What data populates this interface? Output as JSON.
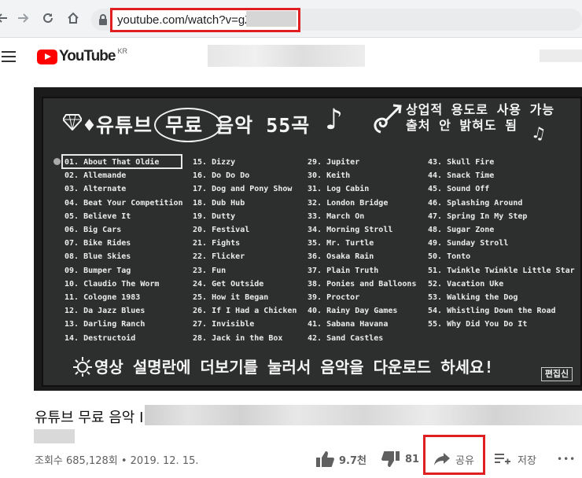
{
  "browser": {
    "url_visible": "youtube.com/watch?v=gZ"
  },
  "header": {
    "logo_text": "YouTube",
    "logo_region": "KR"
  },
  "video": {
    "title_line": "♦유튜브 무료 음악 55곡",
    "commercial_line1": "상업적 용도로 사용 가능",
    "commercial_line2": "출처 안 밝혀도 됨",
    "footer_note": "영상 설명란에 더보기를 눌러서 음악을 다운로드 하세요!",
    "editor_badge": "편집신",
    "songs": [
      [
        "01. About That Oldie",
        "02. Allemande",
        "03. Alternate",
        "04. Beat Your Competition",
        "05. Believe It",
        "06. Big Cars",
        "07. Bike Rides",
        "08. Blue Skies",
        "09. Bumper Tag",
        "10. Claudio The Worm",
        "11. Cologne 1983",
        "12. Da Jazz Blues",
        "13. Darling Ranch",
        "14. Destructoid"
      ],
      [
        "15. Dizzy",
        "16. Do Do Do",
        "17. Dog and Pony Show",
        "18. Dub Hub",
        "19. Dutty",
        "20. Festival",
        "21. Fights",
        "22. Flicker",
        "23. Fun",
        "24. Get Outside",
        "25. How it Began",
        "26. If I Had a Chicken",
        "27. Invisible",
        "28. Jack in the Box"
      ],
      [
        "29. Jupiter",
        "30. Keith",
        "31. Log Cabin",
        "32. London Bridge",
        "33. March On",
        "34. Morning Stroll",
        "35. Mr. Turtle",
        "36. Osaka Rain",
        "37. Plain Truth",
        "38. Ponies and Balloons",
        "39. Proctor",
        "40. Rainy Day Games",
        "41. Sabana Havana",
        "42. Sand Castles"
      ],
      [
        "43. Skull Fire",
        "44. Snack Time",
        "45. Sound Off",
        "46. Splashing Around",
        "47. Spring In My Step",
        "48. Sugar Zone",
        "49. Sunday Stroll",
        "50. Tonto",
        "51. Twinkle Twinkle Little Star",
        "52. Vacation Uke",
        "53. Walking the Dog",
        "54. Whistling Down the Road",
        "55. Why Did You Do It"
      ]
    ]
  },
  "info": {
    "title_prefix": "유튜브 무료 음악 I",
    "views_date": "조회수 685,128회 • 2019. 12. 15.",
    "like_count": "9.7천",
    "dislike_count": "81",
    "share_label": "공유",
    "save_label": "저장",
    "more_label": "•••"
  }
}
